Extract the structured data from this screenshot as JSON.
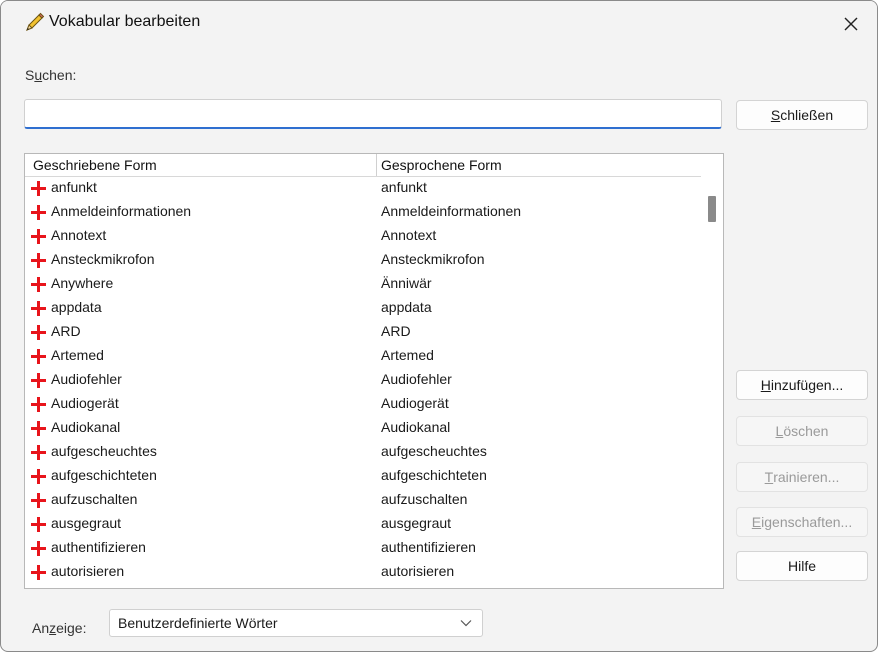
{
  "window": {
    "title": "Vokabular bearbeiten",
    "icon": "pencil-icon",
    "close_icon": "close-icon"
  },
  "search": {
    "label_pre": "S",
    "label_accel": "u",
    "label_post": "chen:",
    "value": "",
    "placeholder": ""
  },
  "buttons": {
    "close_accel": "S",
    "close_rest": "chließen",
    "add_accel": "H",
    "add_rest": "inzufügen...",
    "delete_accel": "L",
    "delete_rest": "öschen",
    "train_accel": "T",
    "train_rest": "rainieren...",
    "props_accel": "E",
    "props_rest": "igenschaften...",
    "help": "Hilfe"
  },
  "list": {
    "columns": [
      "Geschriebene Form",
      "Gesprochene Form"
    ],
    "rows": [
      {
        "written": "anfunkt",
        "spoken": "anfunkt"
      },
      {
        "written": "Anmeldeinformationen",
        "spoken": "Anmeldeinformationen"
      },
      {
        "written": "Annotext",
        "spoken": "Annotext"
      },
      {
        "written": "Ansteckmikrofon",
        "spoken": "Ansteckmikrofon"
      },
      {
        "written": "Anywhere",
        "spoken": "Änniwär"
      },
      {
        "written": "appdata",
        "spoken": "appdata"
      },
      {
        "written": "ARD",
        "spoken": "ARD"
      },
      {
        "written": "Artemed",
        "spoken": "Artemed"
      },
      {
        "written": "Audiofehler",
        "spoken": "Audiofehler"
      },
      {
        "written": "Audiogerät",
        "spoken": "Audiogerät"
      },
      {
        "written": "Audiokanal",
        "spoken": "Audiokanal"
      },
      {
        "written": "aufgescheuchtes",
        "spoken": "aufgescheuchtes"
      },
      {
        "written": "aufgeschichteten",
        "spoken": "aufgeschichteten"
      },
      {
        "written": "aufzuschalten",
        "spoken": "aufzuschalten"
      },
      {
        "written": "ausgegraut",
        "spoken": "ausgegraut"
      },
      {
        "written": "authentifizieren",
        "spoken": "authentifizieren"
      },
      {
        "written": "autorisieren",
        "spoken": "autorisieren"
      }
    ],
    "row_icon": "add-plus-icon"
  },
  "view": {
    "label_pre": "An",
    "label_accel": "z",
    "label_post": "eige:",
    "selected": "Benutzerdefinierte Wörter"
  },
  "colors": {
    "accent": "#2f6fd0",
    "plus_icon": "#e8141b",
    "disabled_text": "#9a9a9a"
  }
}
